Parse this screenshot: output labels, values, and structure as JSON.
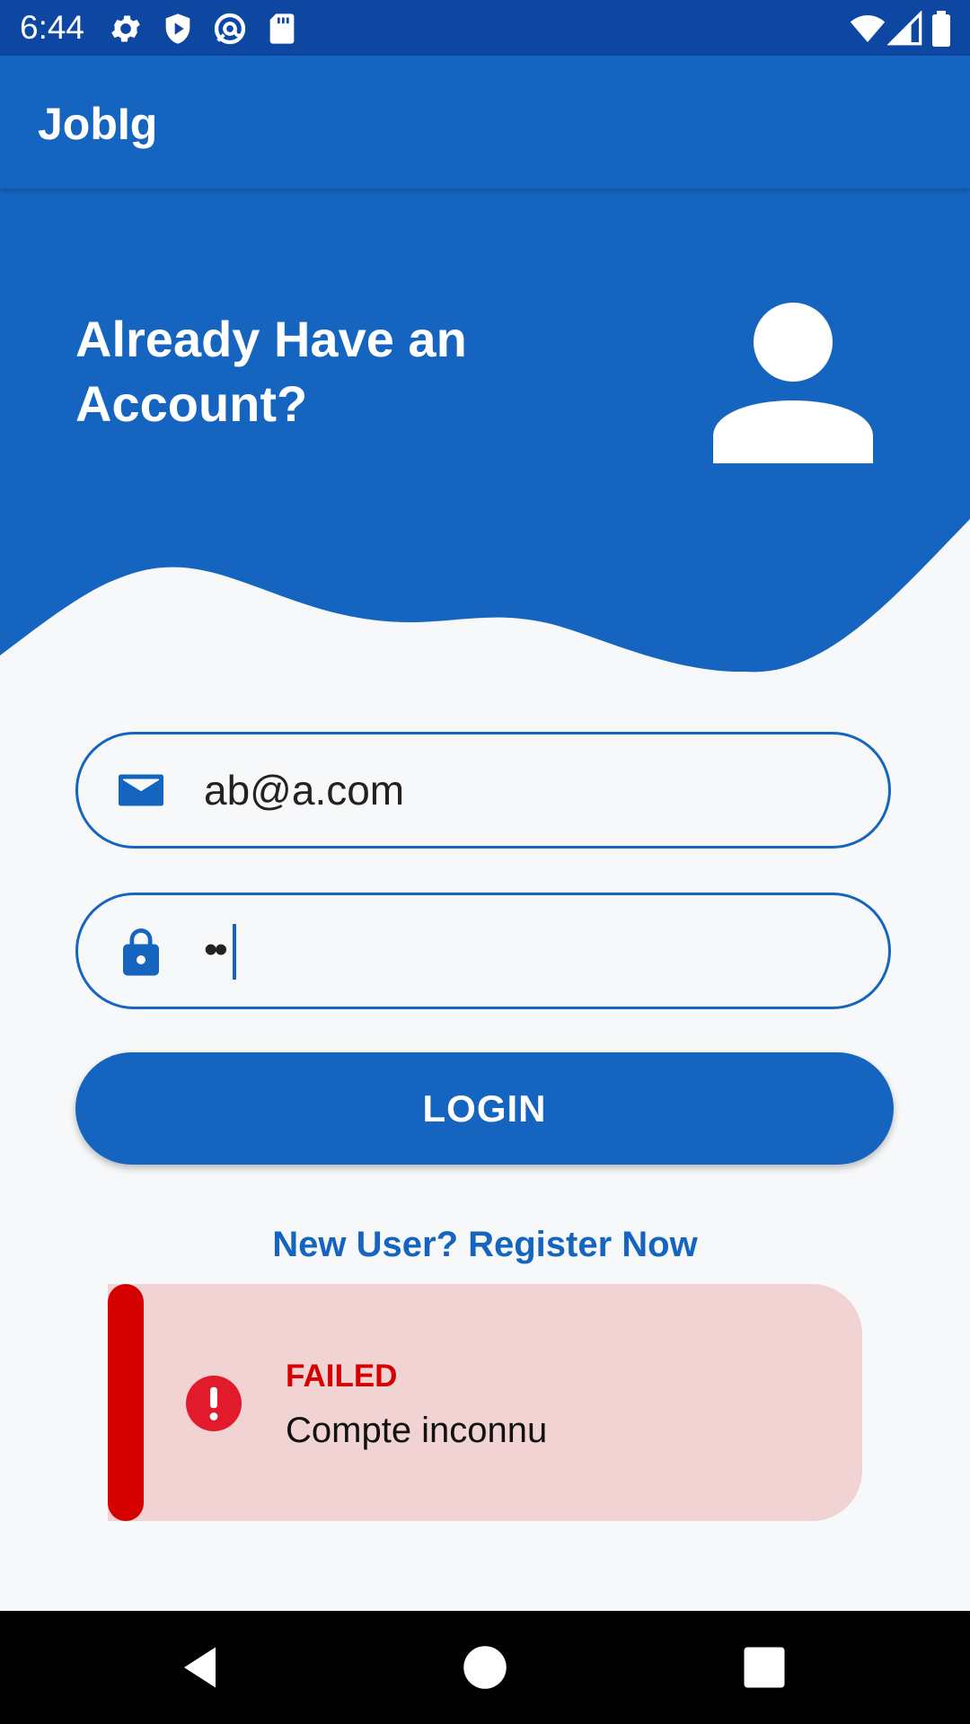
{
  "status_bar": {
    "time": "6:44",
    "icons_left": [
      "settings-icon",
      "shield-play-icon",
      "at-sync-icon",
      "sd-card-icon"
    ],
    "icons_right": [
      "wifi-icon",
      "signal-icon",
      "battery-icon"
    ]
  },
  "app_bar": {
    "title": "JobIg"
  },
  "header": {
    "title": "Already Have an Account?",
    "avatar_icon": "person-icon"
  },
  "form": {
    "email": {
      "icon": "mail-icon",
      "value": "ab@a.com"
    },
    "password": {
      "icon": "lock-icon",
      "value": "••"
    },
    "login_label": "LOGIN",
    "register_link": "New User? Register Now"
  },
  "toast": {
    "icon": "error-icon",
    "title": "FAILED",
    "message": "Compte inconnu"
  },
  "nav_bar": {
    "buttons": [
      "back-icon",
      "home-icon",
      "recents-icon"
    ]
  },
  "colors": {
    "primary": "#1565c0",
    "primary_dark": "#0d47a1",
    "error": "#d50000",
    "toast_background": "#f1d3d3",
    "background": "#f7f8f9"
  }
}
